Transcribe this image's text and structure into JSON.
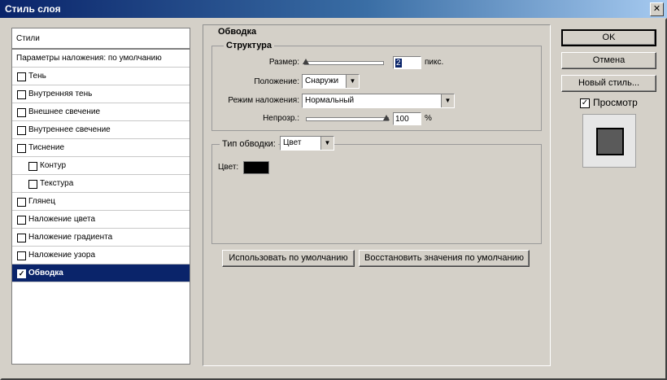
{
  "window": {
    "title": "Стиль слоя",
    "close_icon": "✕"
  },
  "sidebar": {
    "header": "Стили",
    "blending": "Параметры наложения: по умолчанию",
    "items": [
      {
        "label": "Тень",
        "checked": false,
        "check_glyph": ""
      },
      {
        "label": "Внутренняя тень",
        "checked": false,
        "check_glyph": ""
      },
      {
        "label": "Внешнее свечение",
        "checked": false,
        "check_glyph": ""
      },
      {
        "label": "Внутреннее свечение",
        "checked": false,
        "check_glyph": ""
      },
      {
        "label": "Тиснение",
        "checked": false,
        "check_glyph": ""
      },
      {
        "label": "Контур",
        "checked": false,
        "check_glyph": ""
      },
      {
        "label": "Текстура",
        "checked": false,
        "check_glyph": ""
      },
      {
        "label": "Глянец",
        "checked": false,
        "check_glyph": ""
      },
      {
        "label": "Наложение цвета",
        "checked": false,
        "check_glyph": ""
      },
      {
        "label": "Наложение градиента",
        "checked": false,
        "check_glyph": ""
      },
      {
        "label": "Наложение узора",
        "checked": false,
        "check_glyph": ""
      },
      {
        "label": "Обводка",
        "checked": true,
        "check_glyph": "✓"
      }
    ]
  },
  "stroke": {
    "title": "Обводка",
    "structure": {
      "legend": "Структура",
      "size_label": "Размер:",
      "size_value": "2",
      "size_unit": "пикс.",
      "position_label": "Положение:",
      "position_value": "Снаружи",
      "blend_label": "Режим наложения:",
      "blend_value": "Нормальный",
      "opacity_label": "Непрозр.:",
      "opacity_value": "100",
      "opacity_unit": "%"
    },
    "fill": {
      "type_label": "Тип обводки:",
      "type_value": "Цвет",
      "color_label": "Цвет:",
      "color": "#000000"
    },
    "buttons": {
      "make_default": "Использовать по умолчанию",
      "reset_default": "Восстановить значения по умолчанию"
    }
  },
  "actions": {
    "ok": "OK",
    "cancel": "Отмена",
    "new_style": "Новый стиль...",
    "preview_label": "Просмотр",
    "preview_check": "✓"
  },
  "icons": {
    "dropdown_arrow": "▼"
  }
}
